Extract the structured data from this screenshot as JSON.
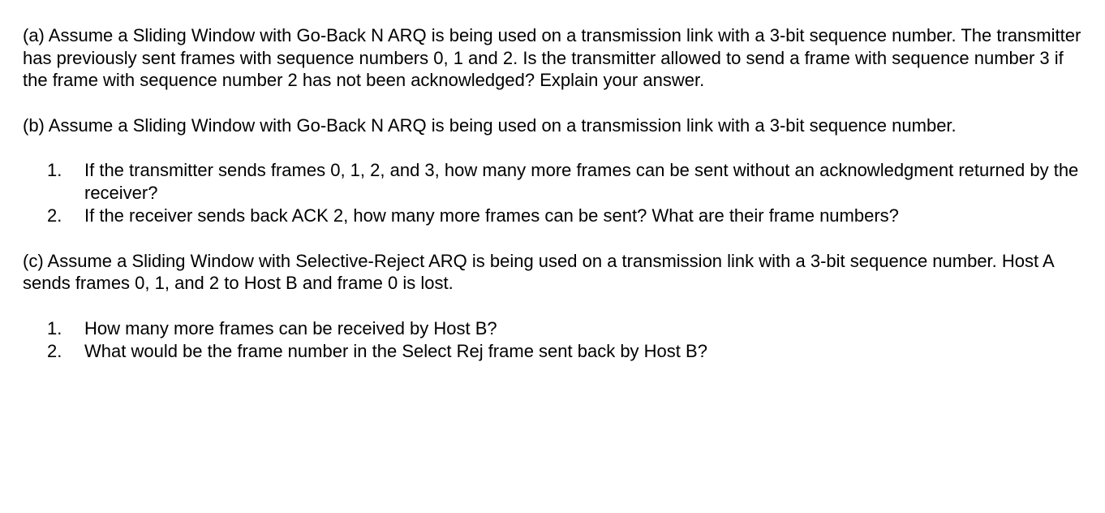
{
  "questions": {
    "a": {
      "text": "(a) Assume a Sliding Window with Go-Back N ARQ is being used on a transmission link with a 3-bit sequence number. The transmitter has previously sent frames with sequence numbers 0, 1 and 2. Is the transmitter allowed to send a frame with sequence number 3 if the frame with sequence number 2 has not been acknowledged? Explain your answer."
    },
    "b": {
      "intro": "(b) Assume a Sliding Window with Go-Back N ARQ is being used on a transmission link with a 3-bit sequence number.",
      "items": [
        {
          "number": "1.",
          "text": "If the transmitter sends frames 0, 1, 2, and 3, how many more frames can be sent without an acknowledgment returned by the receiver?"
        },
        {
          "number": "2.",
          "text": "If the receiver sends back ACK 2, how many more frames can be sent? What are their frame numbers?"
        }
      ]
    },
    "c": {
      "intro": "(c) Assume a Sliding Window with Selective-Reject ARQ is being used on a transmission link with a 3-bit sequence number. Host A sends frames 0, 1, and 2 to Host B and frame 0 is lost.",
      "items": [
        {
          "number": "1.",
          "text": "How many more frames can be received by Host B?"
        },
        {
          "number": "2.",
          "text": "What would be the frame number in the Select Rej frame sent back by Host B?"
        }
      ]
    }
  }
}
